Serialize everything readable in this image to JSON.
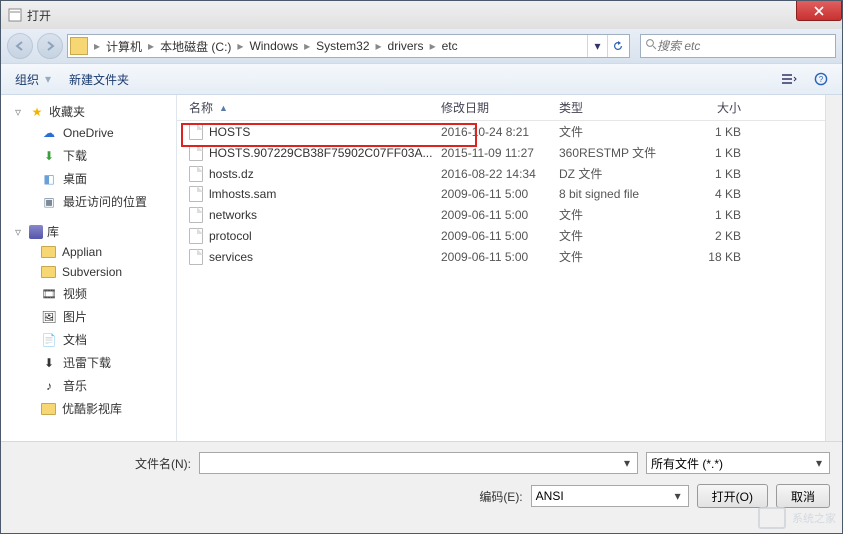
{
  "title": "打开",
  "breadcrumbs": [
    "计算机",
    "本地磁盘 (C:)",
    "Windows",
    "System32",
    "drivers",
    "etc"
  ],
  "search_placeholder": "搜索 etc",
  "toolbar": {
    "organize": "组织",
    "newfolder": "新建文件夹"
  },
  "columns": {
    "name": "名称",
    "date": "修改日期",
    "type": "类型",
    "size": "大小"
  },
  "sidebar": {
    "favorites": {
      "label": "收藏夹",
      "items": [
        "OneDrive",
        "下载",
        "桌面",
        "最近访问的位置"
      ]
    },
    "libraries": {
      "label": "库",
      "items": [
        "Applian",
        "Subversion",
        "视频",
        "图片",
        "文档",
        "迅雷下载",
        "音乐",
        "优酷影视库"
      ]
    }
  },
  "files": [
    {
      "name": "HOSTS",
      "date": "2016-10-24 8:21",
      "type": "文件",
      "size": "1 KB"
    },
    {
      "name": "HOSTS.907229CB38F75902C07FF03A...",
      "date": "2015-11-09 11:27",
      "type": "360RESTMP 文件",
      "size": "1 KB"
    },
    {
      "name": "hosts.dz",
      "date": "2016-08-22 14:34",
      "type": "DZ 文件",
      "size": "1 KB"
    },
    {
      "name": "lmhosts.sam",
      "date": "2009-06-11 5:00",
      "type": "8 bit signed file",
      "size": "4 KB"
    },
    {
      "name": "networks",
      "date": "2009-06-11 5:00",
      "type": "文件",
      "size": "1 KB"
    },
    {
      "name": "protocol",
      "date": "2009-06-11 5:00",
      "type": "文件",
      "size": "2 KB"
    },
    {
      "name": "services",
      "date": "2009-06-11 5:00",
      "type": "文件",
      "size": "18 KB"
    }
  ],
  "bottom": {
    "filename_label": "文件名(N):",
    "filter_value": "所有文件 (*.*)",
    "encoding_label": "编码(E):",
    "encoding_value": "ANSI",
    "open_btn": "打开(O)",
    "cancel_btn": "取消"
  },
  "watermark": "系统之家"
}
